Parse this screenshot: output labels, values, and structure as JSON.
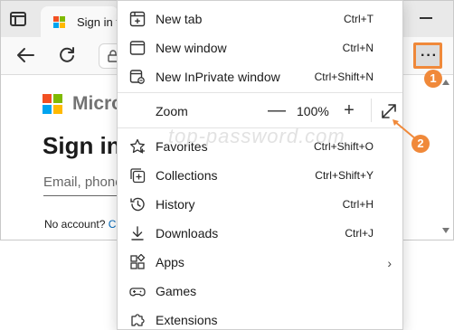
{
  "browser": {
    "tab_title": "Sign in t",
    "window_controls": {
      "minimize_icon": "minimize-icon"
    }
  },
  "page": {
    "ms_wordmark": "Micros",
    "heading": "Sign in",
    "email_placeholder": "Email, phone",
    "no_account_text": "No account?",
    "no_account_link": "C"
  },
  "watermark": "top-password.com",
  "menu": {
    "items_top": [
      {
        "label": "New tab",
        "shortcut": "Ctrl+T",
        "icon": "new-tab-icon"
      },
      {
        "label": "New window",
        "shortcut": "Ctrl+N",
        "icon": "new-window-icon"
      },
      {
        "label": "New InPrivate window",
        "shortcut": "Ctrl+Shift+N",
        "icon": "inprivate-icon"
      }
    ],
    "zoom": {
      "label": "Zoom",
      "minus": "—",
      "value": "100%",
      "plus": "+",
      "fullscreen_icon": "fullscreen-icon"
    },
    "items_bottom": [
      {
        "label": "Favorites",
        "shortcut": "Ctrl+Shift+O",
        "icon": "star-icon"
      },
      {
        "label": "Collections",
        "shortcut": "Ctrl+Shift+Y",
        "icon": "collections-icon"
      },
      {
        "label": "History",
        "shortcut": "Ctrl+H",
        "icon": "history-icon"
      },
      {
        "label": "Downloads",
        "shortcut": "Ctrl+J",
        "icon": "download-icon"
      },
      {
        "label": "Apps",
        "shortcut": "",
        "chevron": "›",
        "icon": "apps-icon"
      },
      {
        "label": "Games",
        "shortcut": "",
        "icon": "games-icon"
      },
      {
        "label": "Extensions",
        "shortcut": "",
        "icon": "extensions-icon"
      }
    ]
  },
  "callouts": {
    "one": "1",
    "two": "2"
  },
  "colors": {
    "accent_orange": "#f0893a",
    "ms_red": "#f25022",
    "ms_green": "#7fba00",
    "ms_blue": "#00a4ef",
    "ms_yellow": "#ffb900",
    "link_blue": "#0067b8"
  }
}
